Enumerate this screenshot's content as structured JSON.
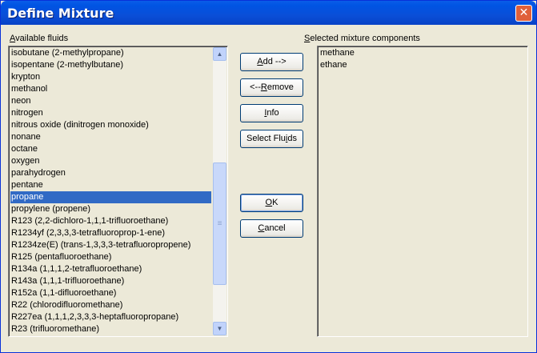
{
  "window": {
    "title": "Define Mixture",
    "close_glyph": "✕"
  },
  "available": {
    "label_underline": "A",
    "label_rest": "vailable fluids",
    "items": [
      "isobutane  (2-methylpropane)",
      "isopentane  (2-methylbutane)",
      "krypton",
      "methanol",
      "neon",
      "nitrogen",
      "nitrous oxide   (dinitrogen monoxide)",
      "nonane",
      "octane",
      "oxygen",
      "parahydrogen",
      "pentane",
      "propane",
      "propylene  (propene)",
      "R123   (2,2-dichloro-1,1,1-trifluoroethane)",
      "R1234yf   (2,3,3,3-tetrafluoroprop-1-ene)",
      "R1234ze(E)   (trans-1,3,3,3-tetrafluoropropene)",
      "R125   (pentafluoroethane)",
      "R134a   (1,1,1,2-tetrafluoroethane)",
      "R143a   (1,1,1-trifluoroethane)",
      "R152a   (1,1-difluoroethane)",
      "R22   (chlorodifluoromethane)",
      "R227ea   (1,1,1,2,3,3,3-heptafluoropropane)",
      "R23   (trifluoromethane)"
    ],
    "selected_item": "propane"
  },
  "selected": {
    "label_underline": "S",
    "label_rest": "elected mixture components",
    "items": [
      "methane",
      "ethane"
    ]
  },
  "buttons": {
    "add": {
      "u": "A",
      "rest": "dd -->"
    },
    "remove": {
      "pre": "<--",
      "u": "R",
      "rest": "emove"
    },
    "info": {
      "u": "I",
      "rest": "nfo"
    },
    "select_fluids": {
      "pre": "Select Flu",
      "u": "i",
      "rest": "ds"
    },
    "ok": {
      "u": "O",
      "rest": "K"
    },
    "cancel": {
      "u": "C",
      "rest": "ancel"
    }
  },
  "scroll": {
    "up_glyph": "▲",
    "down_glyph": "▼",
    "grip_glyph": "≡"
  },
  "colors": {
    "selection": "#316ac5",
    "titlebar": "#0054e3",
    "close": "#e0603a"
  }
}
